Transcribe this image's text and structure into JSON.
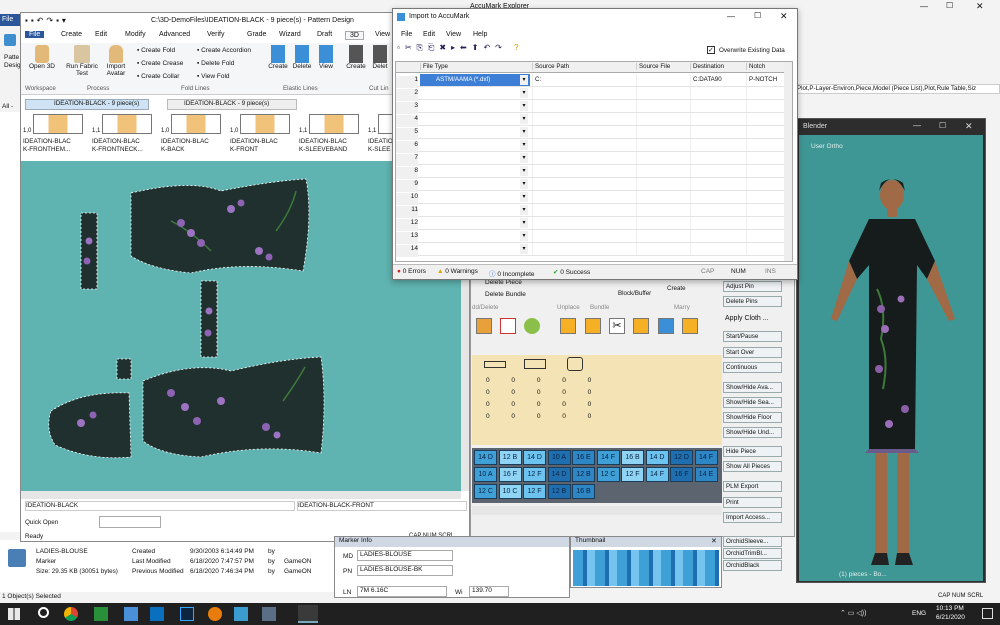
{
  "explorer": {
    "title": "AccuMark Explorer",
    "right_text": "Plot,P-Layer-Environ,Piece,Model (Piece List),Plot,Rule Table,Siz",
    "left_frag_1": "Patte",
    "left_frag_2": "Desig",
    "file_tab": "File",
    "all_frag": "All -"
  },
  "pd": {
    "title": "C:\\3D-DemoFiles\\IDEATION-BLACK - 9 piece(s) - Pattern Design",
    "menu": [
      "File",
      "Create",
      "Edit",
      "Modify",
      "Advanced",
      "Verify",
      "Grade",
      "Wizard",
      "Draft",
      "3D",
      "View"
    ],
    "ribbon": {
      "open3d": "Open 3D",
      "run_fabric": "Run Fabric Test",
      "import_avatar": "Import Avatar",
      "create_fold": "Create Fold",
      "create_crease": "Create Crease",
      "create_collar": "Create Collar",
      "create_accordion": "Create Accordion",
      "delete_fold": "Delete Fold",
      "view_fold": "View Fold",
      "create": "Create",
      "delete": "Delete",
      "view": "View",
      "create2": "Create",
      "delete2": "Delet"
    },
    "groups": [
      "Workspace",
      "Process",
      "Fold Lines",
      "Elastic Lines",
      "Cut Lin"
    ],
    "tabs": [
      "IDEATION-BLACK - 9 piece(s)",
      "IDEATION-BLACK - 9 piece(s)"
    ],
    "pieces": [
      {
        "scale": "1,0",
        "name": "IDEATION-BLAC\nK-FRONTHEM..."
      },
      {
        "scale": "1,1",
        "name": "IDEATION-BLAC\nK-FRONTNECK..."
      },
      {
        "scale": "1,0",
        "name": "IDEATION-BLAC\nK-BACK"
      },
      {
        "scale": "1,0",
        "name": "IDEATION-BLAC\nK-FRONT"
      },
      {
        "scale": "1,1",
        "name": "IDEATION-BLAC\nK-SLEEVEBAND"
      },
      {
        "scale": "1,1",
        "name": "IDEATION-BLAC\nK-SLEE"
      }
    ],
    "status_left": "IDEATION-BLACK",
    "status_right": "IDEATION-BLACK-FRONT",
    "quick_open": "Quick Open",
    "ready": "Ready",
    "caps": [
      "CAP",
      "NUM",
      "SCRL"
    ]
  },
  "imp": {
    "title": "Import to AccuMark",
    "menu": [
      "File",
      "Edit",
      "View",
      "Help"
    ],
    "overwrite": "Overwrite Existing Data",
    "headers": [
      "File Type",
      "Source Path",
      "Source File",
      "Destination",
      "Notch"
    ],
    "first_row": [
      "ASTM/AAMA (*.dxf)",
      "C:",
      "",
      "C:DATA90",
      "P-NOTCH"
    ],
    "rows": [
      "1",
      "2",
      "3",
      "4",
      "5",
      "6",
      "7",
      "8",
      "9",
      "10",
      "11",
      "12",
      "13",
      "14"
    ],
    "status": {
      "errors": "0 Errors",
      "warnings": "0 Warnings",
      "incomplete": "0 Incomplete",
      "success": "0 Success",
      "caps": [
        "CAP",
        "NUM",
        "INS"
      ]
    }
  },
  "marker": {
    "delete_piece": "Delete Piece",
    "delete_bundle": "Delete Bundle",
    "add_delete": "dd/Delete",
    "unplace": "Unplace",
    "bundle": "Bundle",
    "block_buffer": "Block/Buffer",
    "create": "Create",
    "marry": "Marry",
    "piece_labels": [
      "14 D",
      "12 B",
      "14 D",
      "10 A",
      "16 E",
      "14 F",
      "16 B",
      "14 D",
      "12 D",
      "14 F",
      "10 A",
      "16 F",
      "12 F",
      "14 D",
      "12 B",
      "12 C",
      "12 F",
      "14 F",
      "16 F",
      "14 E",
      "12 C",
      "10 C",
      "12 F",
      "12 B",
      "16 B"
    ]
  },
  "buttons": [
    "Adjust Pin",
    "Delete Pins",
    "Apply Cloth ...",
    "Start/Pause",
    "Start Over",
    "Continuous",
    "Show/Hide Ava...",
    "Show/Hide Sea...",
    "Show/Hide Floor",
    "Show/Hide Und...",
    "Hide Piece",
    "Show All Pieces",
    "PLM Export",
    "Print",
    "Import Access...",
    "OrchidSleeve...",
    "OrchidTrimBl...",
    "OrchidBlack"
  ],
  "blender": {
    "title": "Blender",
    "view": "User Ortho",
    "caption": "(1) pieces - Bo..."
  },
  "details": {
    "name": "LADIES-BLOUSE",
    "type": "Marker",
    "size": "Size: 29.35 KB (30051 bytes)",
    "created_lbl": "Created",
    "modified_lbl": "Last Modified",
    "prev_lbl": "Previous Modified",
    "created": "9/30/2003 6:14:49 PM",
    "modified": "6/18/2020 7:47:57 PM",
    "prev": "6/18/2020 7:46:34 PM",
    "by": "by",
    "user": "GameON",
    "selected": "1 Object(s) Selected"
  },
  "markerinfo": {
    "title": "Marker Info",
    "md_lbl": "MD",
    "md": "LADIES-BLOUSE",
    "pn_lbl": "PN",
    "pn": "LADIES-BLOUSE-BK",
    "ln_lbl": "LN",
    "ln": "7M 6.16C",
    "wi_lbl": "Wi",
    "wi": "139.70"
  },
  "thumb": {
    "title": "Thumbnail"
  },
  "taskbar": {
    "time": "10:13 PM",
    "date": "6/21/2020",
    "lang": "ENG",
    "capnum": "CAP NUM SCRL"
  },
  "colors": {
    "canvas": "#5fb3b0",
    "fabric": "#1f302f",
    "ribbon_blue": "#2b579a",
    "marker_blue": "#3fa0d8",
    "titlebar": "#ffffff",
    "taskbar": "#202020"
  }
}
